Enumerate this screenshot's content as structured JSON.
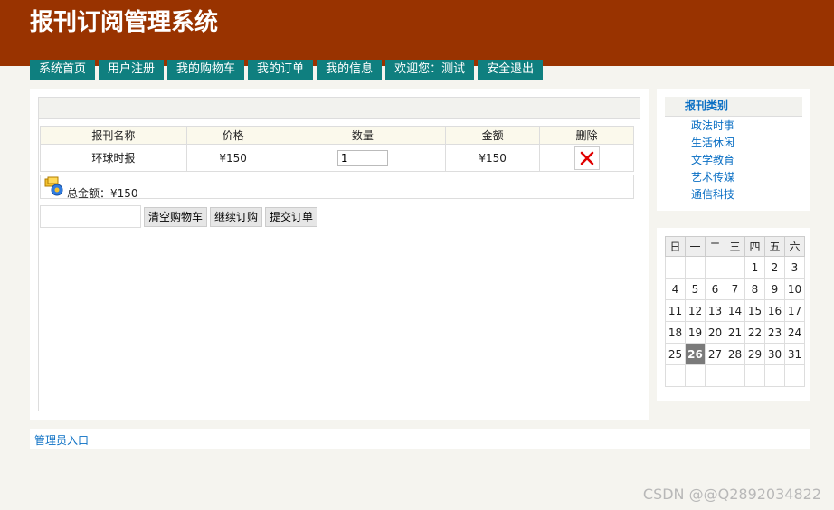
{
  "site": {
    "title": "报刊订阅管理系统"
  },
  "nav": [
    {
      "label": "系统首页"
    },
    {
      "label": "用户注册"
    },
    {
      "label": "我的购物车"
    },
    {
      "label": "我的订单"
    },
    {
      "label": "我的信息"
    },
    {
      "label": "欢迎您：测试"
    },
    {
      "label": "安全退出"
    }
  ],
  "cart": {
    "columns": [
      "报刊名称",
      "价格",
      "数量",
      "金额",
      "删除"
    ],
    "rows": [
      {
        "name": "环球时报",
        "price": "¥150",
        "quantity": "1",
        "amount": "¥150"
      }
    ],
    "total": "总金额：¥150",
    "buttons": {
      "clear": "清空购物车",
      "continue": "继续订购",
      "submit": "提交订单"
    },
    "delete_icon": "delete-x-icon",
    "total_icon": "money-bag-icon"
  },
  "categories": {
    "title": "报刊类别",
    "items": [
      "政法时事",
      "生活休闲",
      "文学教育",
      "艺术传媒",
      "通信科技"
    ]
  },
  "calendar": {
    "weekdays": [
      "日",
      "一",
      "二",
      "三",
      "四",
      "五",
      "六"
    ],
    "weeks": [
      [
        "",
        "",
        "",
        "",
        "1",
        "2",
        "3"
      ],
      [
        "4",
        "5",
        "6",
        "7",
        "8",
        "9",
        "10"
      ],
      [
        "11",
        "12",
        "13",
        "14",
        "15",
        "16",
        "17"
      ],
      [
        "18",
        "19",
        "20",
        "21",
        "22",
        "23",
        "24"
      ],
      [
        "25",
        "26",
        "27",
        "28",
        "29",
        "30",
        "31"
      ],
      [
        "",
        "",
        "",
        "",
        "",
        "",
        ""
      ]
    ],
    "today": "26"
  },
  "footer": {
    "admin_link": "管理员入口"
  },
  "watermark": "CSDN @@Q2892034822",
  "colors": {
    "header": "#993300",
    "nav": "#0f7f7f",
    "link": "#0a6fc4"
  }
}
